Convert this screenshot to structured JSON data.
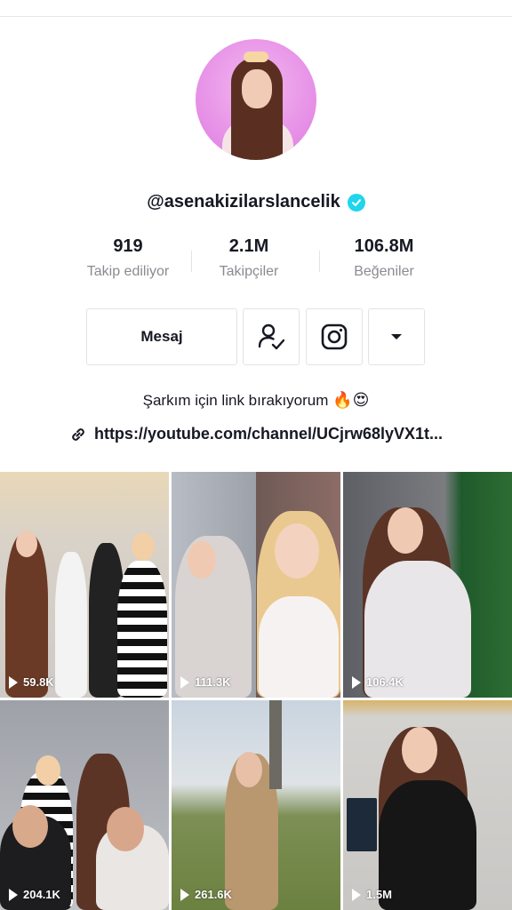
{
  "profile": {
    "username": "@asenakizilarslancelik",
    "verified": true,
    "bio": "Şarkım için link bırakıyorum",
    "bio_emojis": "🔥😍",
    "link": "https://youtube.com/channel/UCjrw68lyVX1t..."
  },
  "stats": [
    {
      "value": "919",
      "label": "Takip ediliyor"
    },
    {
      "value": "2.1M",
      "label": "Takipçiler"
    },
    {
      "value": "106.8M",
      "label": "Beğeniler"
    }
  ],
  "actions": {
    "message_label": "Mesaj",
    "follow_icon": "user-check-icon",
    "instagram_icon": "instagram-icon",
    "more_icon": "caret-down-icon"
  },
  "videos": [
    {
      "views": "59.8K"
    },
    {
      "views": "111.3K"
    },
    {
      "views": "106.4K"
    },
    {
      "views": "204.1K"
    },
    {
      "views": "261.6K"
    },
    {
      "views": "1.5M"
    }
  ],
  "colors": {
    "verified": "#20d5ec",
    "text": "#161823",
    "secondary_text": "#8a8b91",
    "border": "#e3e3e4"
  }
}
